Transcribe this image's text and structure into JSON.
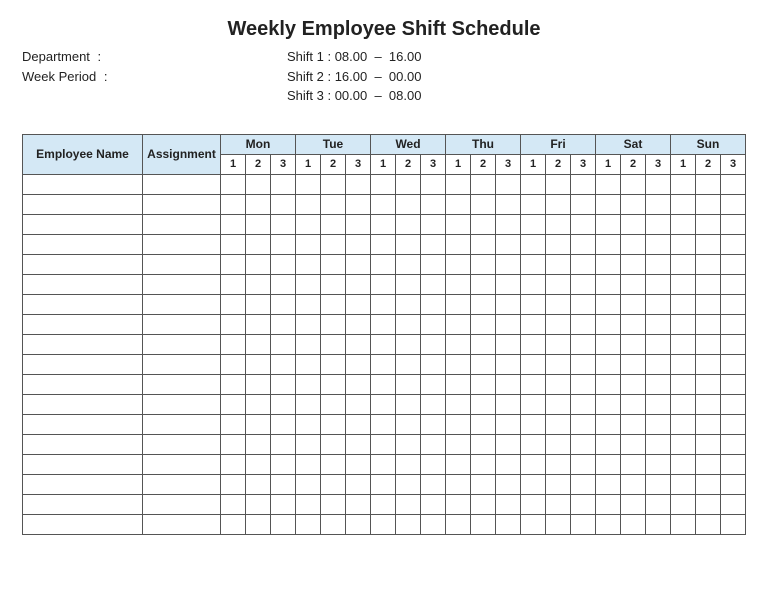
{
  "title": "Weekly Employee Shift Schedule",
  "meta": {
    "department_label": "Department",
    "department_value": "",
    "week_period_label": "Week Period",
    "week_period_value": ""
  },
  "shifts": [
    {
      "label": "Shift 1",
      "time": "08.00  –  16.00"
    },
    {
      "label": "Shift 2",
      "time": "16.00  –  00.00"
    },
    {
      "label": "Shift 3",
      "time": "00.00  –  08.00"
    }
  ],
  "columns": {
    "employee": "Employee Name",
    "assignment": "Assignment",
    "days": [
      "Mon",
      "Tue",
      "Wed",
      "Thu",
      "Fri",
      "Sat",
      "Sun"
    ],
    "shift_nums": [
      "1",
      "2",
      "3"
    ]
  },
  "row_count": 18
}
